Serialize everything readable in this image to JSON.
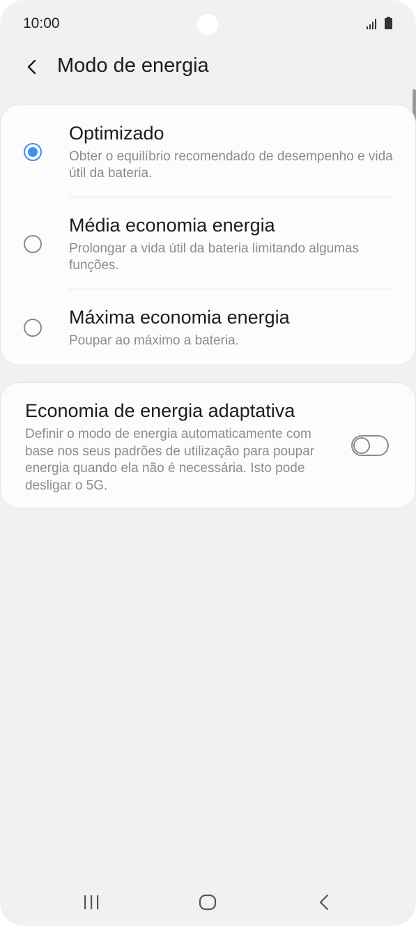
{
  "status_bar": {
    "time": "10:00"
  },
  "header": {
    "title": "Modo de energia",
    "back_icon": "chevron-left-icon"
  },
  "power_modes": {
    "selected": "optimized",
    "options": [
      {
        "id": "optimized",
        "title": "Optimizado",
        "description": "Obter o equilíbrio recomendado de desempenho e vida útil da bateria.",
        "checked": true
      },
      {
        "id": "medium",
        "title": "Média economia energia",
        "description": "Prolongar a vida útil da bateria limitando algumas funções.",
        "checked": false
      },
      {
        "id": "maximum",
        "title": "Máxima economia energia",
        "description": "Poupar ao máximo a bateria.",
        "checked": false
      }
    ]
  },
  "adaptive": {
    "title": "Economia de energia adaptativa",
    "description": "Definir o modo de energia automaticamente com base nos seus padrões de utilização para poupar energia quando ela não é necessária. Isto pode desligar o 5G.",
    "enabled": false
  },
  "nav_bar": {
    "recent_icon": "recent-apps-icon",
    "home_icon": "home-icon",
    "back_icon": "back-icon"
  },
  "colors": {
    "background": "#f1f1f1",
    "card": "#fcfcfc",
    "accent": "#3e91f1",
    "primary_text": "#1c1c1c",
    "secondary_text": "#8c8c8c"
  }
}
